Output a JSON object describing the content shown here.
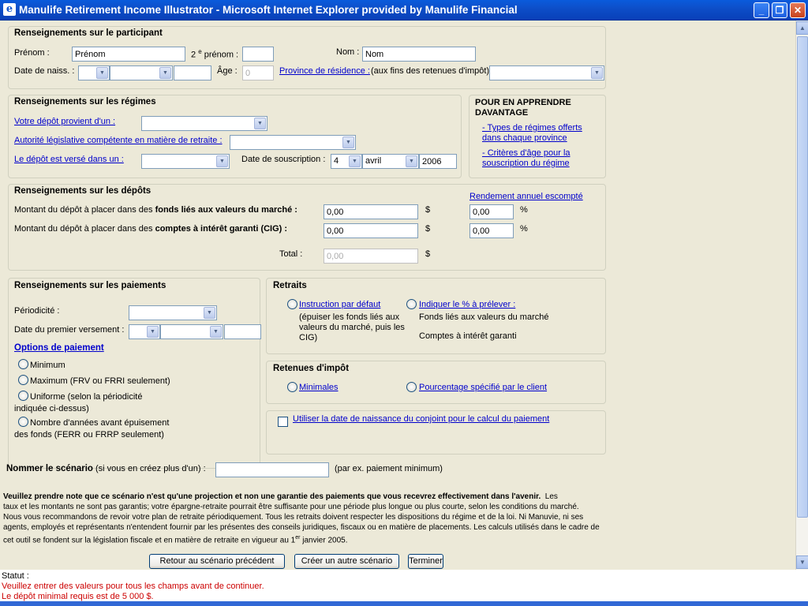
{
  "window": {
    "title": "Manulife Retirement Income Illustrator - Microsoft Internet Explorer provided by Manulife Financial",
    "icon": "ie-icon",
    "minimize": "_",
    "maximize": "❐",
    "close": "✕"
  },
  "participant": {
    "heading": "Renseignements sur le participant",
    "firstname_label": "Prénom :",
    "firstname_value": "Prénom",
    "second_name_label_pre": "2",
    "second_name_label_sup": "e",
    "second_name_label_post": "prénom :",
    "lastname_label": "Nom :",
    "lastname_value": "Nom",
    "dob_label": "Date de naiss. :",
    "age_label": "Âge :",
    "age_value": "0",
    "province_link": "Province de résidence :",
    "province_note": "(aux fins des retenues d'impôt)"
  },
  "plans": {
    "heading": "Renseignements sur les régimes",
    "deposit_source_link": "Votre dépôt provient d'un :",
    "authority_link": "Autorité législative compétente en matière de retraite :",
    "deposit_in_link": "Le dépôt est versé dans un :",
    "subscription_label": "Date de souscription :",
    "sub_day": "4",
    "sub_month": "avril",
    "sub_year": "2006"
  },
  "learn_more": {
    "heading_line1": "POUR EN APPRENDRE",
    "heading_line2": "DAVANTAGE",
    "link1_line1": "- Types de régimes offerts",
    "link1_line2": "dans chaque province",
    "link2_line1": "- Critères d'âge pour la",
    "link2_line2": "souscription du régime"
  },
  "deposits": {
    "heading": "Renseignements sur les dépôts",
    "yield_link": "Rendement annuel escompté",
    "market_label_pre": "Montant du dépôt à placer dans des",
    "market_label_bold": "fonds liés aux valeurs du marché :",
    "market_value": "0,00",
    "market_rate": "0,00",
    "gic_label_pre": "Montant du dépôt à placer dans des",
    "gic_label_bold": "comptes à intérêt garanti (CIG) :",
    "gic_value": "0,00",
    "gic_rate": "0,00",
    "currency": "$",
    "percent": "%",
    "total_label": "Total :",
    "total_value": "0,00"
  },
  "payments": {
    "heading": "Renseignements sur les paiements",
    "frequency_label": "Périodicité :",
    "first_payment_label": "Date du premier versement :",
    "options_link": "Options de paiement",
    "opt_min": "Minimum",
    "opt_max": "Maximum (FRV ou FRRI seulement)",
    "opt_uniform_line1": "Uniforme (selon la périodicité",
    "opt_uniform_line2": "indiquée ci-dessus)",
    "opt_years_line1": "Nombre d'années avant épuisement",
    "opt_years_line2": "des fonds (FERR ou FRRP seulement)"
  },
  "withdrawals": {
    "heading": "Retraits",
    "default_link": "Instruction par défaut",
    "default_desc_line1": "(épuiser les fonds liés aux",
    "default_desc_line2": "valeurs du marché, puis les",
    "default_desc_line3": "CIG)",
    "percent_link": "Indiquer le % à prélever :",
    "market_funds": "Fonds liés aux valeurs du marché",
    "gic_accounts": "Comptes à intérêt garanti"
  },
  "tax": {
    "heading": "Retenues d'impôt",
    "minimal_link": "Minimales",
    "client_link": "Pourcentage spécifié par le client"
  },
  "spouse": {
    "checkbox_link": "Utiliser la date de naissance du conjoint pour le calcul du paiement"
  },
  "scenario": {
    "label_bold": "Nommer le scénario",
    "label_rest": "(si vous en créez plus d'un) :",
    "example": "(par ex. paiement minimum)"
  },
  "disclaimer": {
    "bold": "Veuillez prendre note que ce scénario n'est qu'une projection et non une garantie des paiements que vous recevrez effectivement dans l'avenir.",
    "line1_rest": "Les",
    "line2": "taux et les montants ne sont pas garantis; votre épargne-retraite pourrait être suffisante pour une période plus longue ou plus courte, selon les conditions du marché.",
    "line3": "Nous vous recommandons de revoir votre plan de retraite périodiquement. Tous les retraits doivent respecter les dispositions du régime et de la loi. Ni Manuvie, ni ses",
    "line4": "agents, employés et représentants n'entendent fournir par les présentes des conseils juridiques, fiscaux ou en matière de placements. Les calculs utilisés dans le cadre de",
    "line5_pre": "cet outil se fondent sur la législation fiscale et en matière de retraite en vigueur au 1",
    "line5_sup": "er",
    "line5_post": "janvier 2005."
  },
  "buttons": {
    "previous": "Retour au scénario précédent",
    "new": "Créer un autre scénario",
    "finish": "Terminer"
  },
  "status": {
    "label": "Statut :",
    "msg1": "Veuillez entrer des valeurs pour tous les champs avant de continuer.",
    "msg2": "Le dépôt minimal requis est de 5 000 $."
  },
  "colors": {
    "link": "#0000cc",
    "error": "#cc0000",
    "background": "#ece9d8",
    "titlebar": "#0a5bdc"
  }
}
